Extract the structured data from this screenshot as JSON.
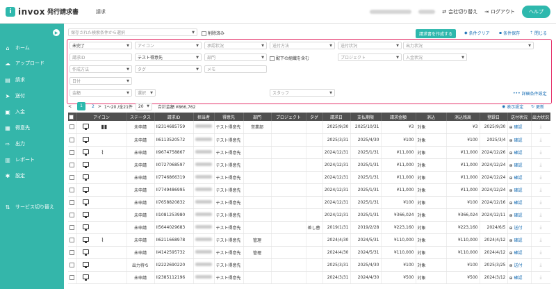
{
  "header": {
    "logo_mark": "i",
    "logo_name": "invox",
    "logo_sub": "発行請求書",
    "crumb": "請求",
    "company_switch": "会社切り替え",
    "logout": "ログアウト",
    "help": "ヘルプ"
  },
  "sidebar": {
    "items": [
      {
        "label": "ホーム",
        "icon": "home-icon"
      },
      {
        "label": "アップロード",
        "icon": "upload-icon"
      },
      {
        "label": "請求",
        "icon": "invoice-icon"
      },
      {
        "label": "送付",
        "icon": "send-icon"
      },
      {
        "label": "入金",
        "icon": "payment-icon"
      },
      {
        "label": "得意先",
        "icon": "customer-icon"
      },
      {
        "label": "出力",
        "icon": "export-icon"
      },
      {
        "label": "レポート",
        "icon": "report-icon"
      },
      {
        "label": "設定",
        "icon": "settings-icon"
      },
      {
        "label": "サービス切り替え",
        "icon": "switch-icon"
      }
    ]
  },
  "toolbar": {
    "saved_search_placeholder": "保存された検索条件から選択",
    "deleted_label": "削除済み",
    "create_button": "請求書を作成する",
    "clear_conditions": "条件クリア",
    "save_conditions": "条件保存",
    "close": "閉じる"
  },
  "filters": {
    "status": "未完了",
    "icon": "アイコン",
    "approval": "承認状況",
    "send_method": "送付方法",
    "send_status": "送付状況",
    "output_status": "出力状況",
    "invoice_id": "請求ID",
    "customer": "テスト得意先",
    "department": "部門",
    "include_sub_org": "配下の組織を含む",
    "project": "プロジェクト",
    "payment_status": "入金状況",
    "creation_method": "作成方法",
    "tag": "タグ",
    "memo": "メモ",
    "date": "日付",
    "amount": "金額",
    "selection": "選択",
    "staff": "スタッフ",
    "detail_settings": "詳細条件設定"
  },
  "pager": {
    "prev": "<",
    "page1": "1",
    "page2": "2",
    "next": ">",
    "range": "1〜20 /全21件",
    "per_page": "20",
    "total": "合計金額 ¥866,762",
    "display_settings": "表示設定",
    "refresh": "更新"
  },
  "table": {
    "headers": [
      "",
      "アイコン",
      "ステータス",
      "請求ID",
      "担当者",
      "得意先",
      "部門",
      "プロジェクト",
      "タグ",
      "請求日",
      "支払期限",
      "請求金額",
      "消込",
      "消込残高",
      "登録日",
      "送付状況",
      "出力状況"
    ],
    "rows": [
      {
        "icon2": "book",
        "status": "未申請",
        "id": "II2314685759",
        "customer": "テスト得意先",
        "dept": "営業部",
        "tag": "",
        "date": "2025/9/30",
        "due": "2025/10/31",
        "amount": "¥3",
        "recon": "対象",
        "balance": "¥3",
        "reg": "2025/9/30",
        "send": "確認"
      },
      {
        "icon2": "",
        "status": "未申請",
        "id": "II6113520572",
        "customer": "テスト得意先",
        "dept": "",
        "tag": "",
        "date": "2025/3/31",
        "due": "2025/4/30",
        "amount": "¥100",
        "recon": "対象",
        "balance": "¥100",
        "reg": "2025/3/4",
        "send": "確認"
      },
      {
        "icon2": "clip",
        "status": "未申請",
        "id": "II9674758867",
        "customer": "テスト得意先",
        "dept": "",
        "tag": "",
        "date": "2024/12/31",
        "due": "2025/1/31",
        "amount": "¥11,000",
        "recon": "対象",
        "balance": "¥11,000",
        "reg": "2024/12/26",
        "send": "確認"
      },
      {
        "icon2": "",
        "status": "未申請",
        "id": "II0727068597",
        "customer": "テスト得意先",
        "dept": "",
        "tag": "",
        "date": "2024/12/31",
        "due": "2025/1/31",
        "amount": "¥11,000",
        "recon": "対象",
        "balance": "¥11,000",
        "reg": "2024/12/24",
        "send": "確認"
      },
      {
        "icon2": "",
        "status": "未申請",
        "id": "II7746866319",
        "customer": "テスト得意先",
        "dept": "",
        "tag": "",
        "date": "2024/12/31",
        "due": "2025/1/31",
        "amount": "¥11,000",
        "recon": "対象",
        "balance": "¥11,000",
        "reg": "2024/12/24",
        "send": "確認"
      },
      {
        "icon2": "",
        "status": "未申請",
        "id": "II7749486995",
        "customer": "テスト得意先",
        "dept": "",
        "tag": "",
        "date": "2024/12/31",
        "due": "2025/1/31",
        "amount": "¥11,000",
        "recon": "対象",
        "balance": "¥11,000",
        "reg": "2024/12/24",
        "send": "確認"
      },
      {
        "icon2": "",
        "status": "未申請",
        "id": "II7658820832",
        "customer": "テスト得意先",
        "dept": "",
        "tag": "",
        "date": "2024/12/31",
        "due": "2025/1/31",
        "amount": "¥100",
        "recon": "対象",
        "balance": "¥100",
        "reg": "2024/12/16",
        "send": "確認"
      },
      {
        "icon2": "",
        "status": "未申請",
        "id": "II1081253980",
        "customer": "テスト得意先",
        "dept": "",
        "tag": "",
        "date": "2024/12/31",
        "due": "2025/1/31",
        "amount": "¥366,024",
        "recon": "対象",
        "balance": "¥366,024",
        "reg": "2024/12/11",
        "send": "確認"
      },
      {
        "icon2": "chip",
        "status": "未申請",
        "id": "II5644029683",
        "customer": "テスト得意先",
        "dept": "",
        "tag": "差し替",
        "date": "2019/1/31",
        "due": "2019/2/28",
        "amount": "¥223,160",
        "recon": "対象",
        "balance": "¥223,160",
        "reg": "2024/6/5",
        "send": "送付"
      },
      {
        "icon2": "clip",
        "status": "未申請",
        "id": "II6211668978",
        "customer": "テスト得意先",
        "dept": "管理",
        "tag": "",
        "date": "2024/4/30",
        "due": "2024/5/31",
        "amount": "¥110,000",
        "recon": "対象",
        "balance": "¥110,000",
        "reg": "2024/4/12",
        "send": "確認"
      },
      {
        "icon2": "",
        "status": "未申請",
        "id": "II4142595732",
        "customer": "テスト得意先",
        "dept": "管理",
        "tag": "",
        "date": "2024/4/30",
        "due": "2024/5/31",
        "amount": "¥110,000",
        "recon": "対象",
        "balance": "¥110,000",
        "reg": "2024/4/12",
        "send": "確認"
      },
      {
        "icon2": "",
        "status": "出力待ち",
        "id": "II2222690220",
        "customer": "テスト得意先",
        "dept": "",
        "tag": "",
        "date": "2025/3/31",
        "due": "2025/4/30",
        "amount": "¥100",
        "recon": "対象",
        "balance": "¥100",
        "reg": "2025/3/25",
        "send": "送付"
      },
      {
        "icon2": "",
        "status": "未申請",
        "id": "II2385112196",
        "customer": "テスト得意先",
        "dept": "",
        "tag": "",
        "date": "2024/3/31",
        "due": "2024/4/30",
        "amount": "¥500",
        "recon": "対象",
        "balance": "¥500",
        "reg": "2024/3/12",
        "send": "確認"
      }
    ]
  }
}
